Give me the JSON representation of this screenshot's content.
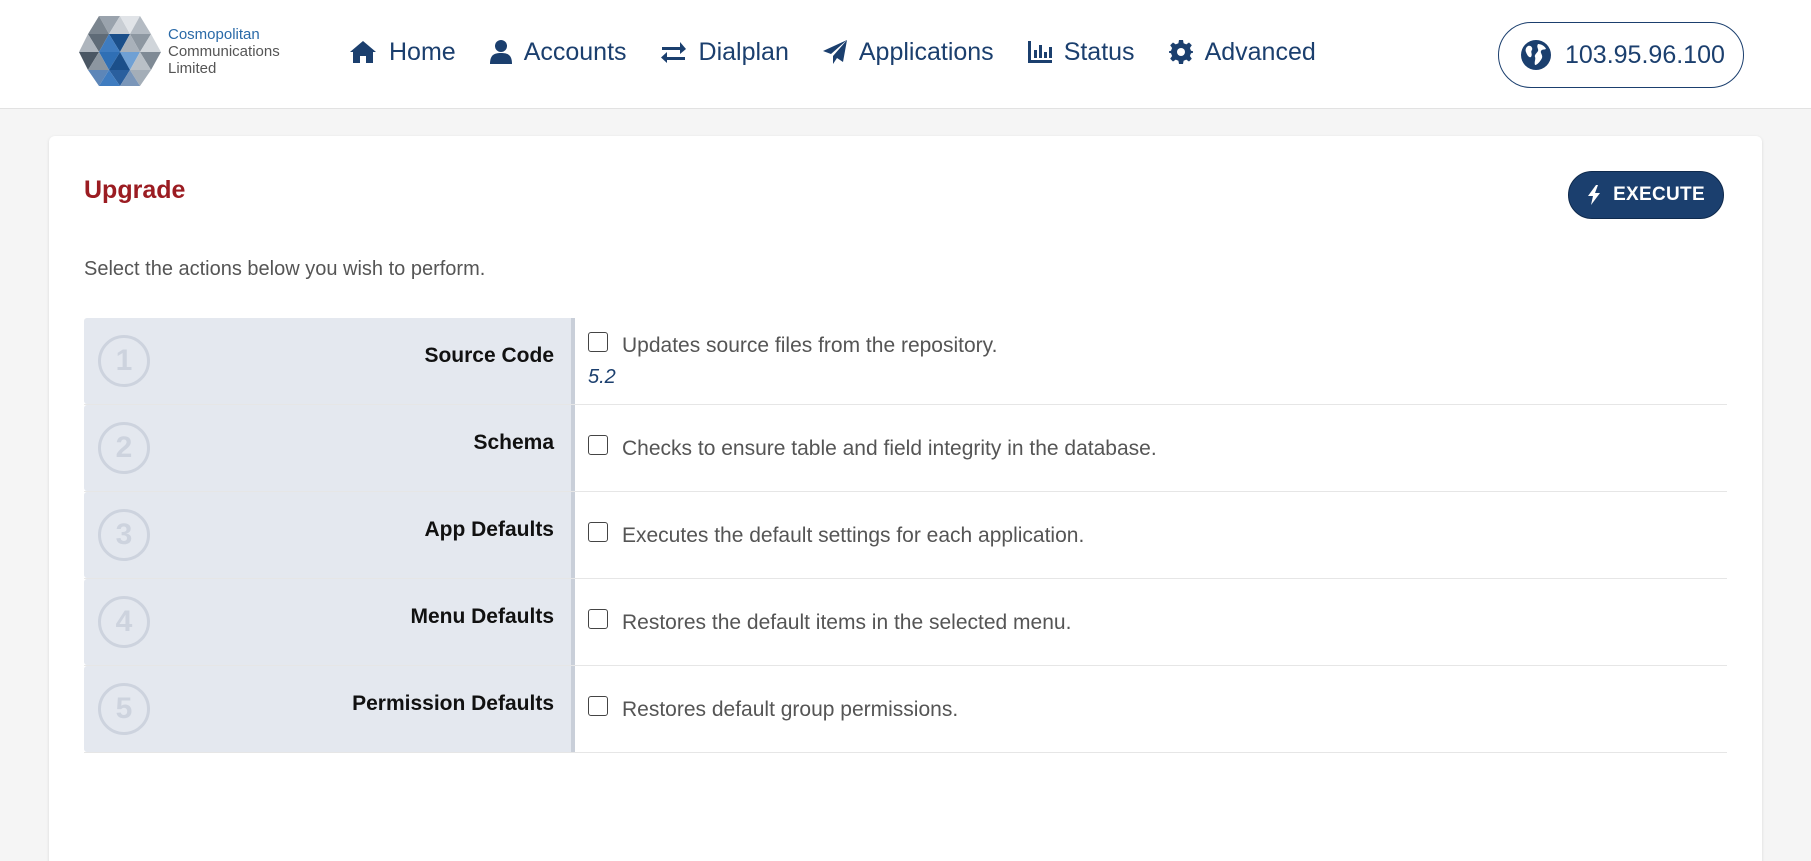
{
  "logo": {
    "line1": "Cosmopolitan",
    "line2": "Communications",
    "line3": "Limited"
  },
  "nav": [
    {
      "label": "Home",
      "icon": "home-icon"
    },
    {
      "label": "Accounts",
      "icon": "user-icon"
    },
    {
      "label": "Dialplan",
      "icon": "exchange-icon"
    },
    {
      "label": "Applications",
      "icon": "paper-plane-icon"
    },
    {
      "label": "Status",
      "icon": "chart-icon"
    },
    {
      "label": "Advanced",
      "icon": "gear-icon"
    }
  ],
  "ip": {
    "label": "103.95.96.100",
    "icon": "globe-icon"
  },
  "page": {
    "title": "Upgrade",
    "execute_label": "EXECUTE",
    "description": "Select the actions below you wish to perform."
  },
  "actions": [
    {
      "number": "1",
      "label": "Source Code",
      "description": "Updates source files from the repository.",
      "version": "5.2",
      "checked": false
    },
    {
      "number": "2",
      "label": "Schema",
      "description": "Checks to ensure table and field integrity in the database.",
      "checked": false
    },
    {
      "number": "3",
      "label": "App Defaults",
      "description": "Executes the default settings for each application.",
      "checked": false
    },
    {
      "number": "4",
      "label": "Menu Defaults",
      "description": "Restores the default items in the selected menu.",
      "checked": false
    },
    {
      "number": "5",
      "label": "Permission Defaults",
      "description": "Restores default group permissions.",
      "checked": false
    }
  ],
  "colors": {
    "primary": "#1b3f6e",
    "title": "#9b1c22",
    "label_bg": "#e4e8ef"
  }
}
